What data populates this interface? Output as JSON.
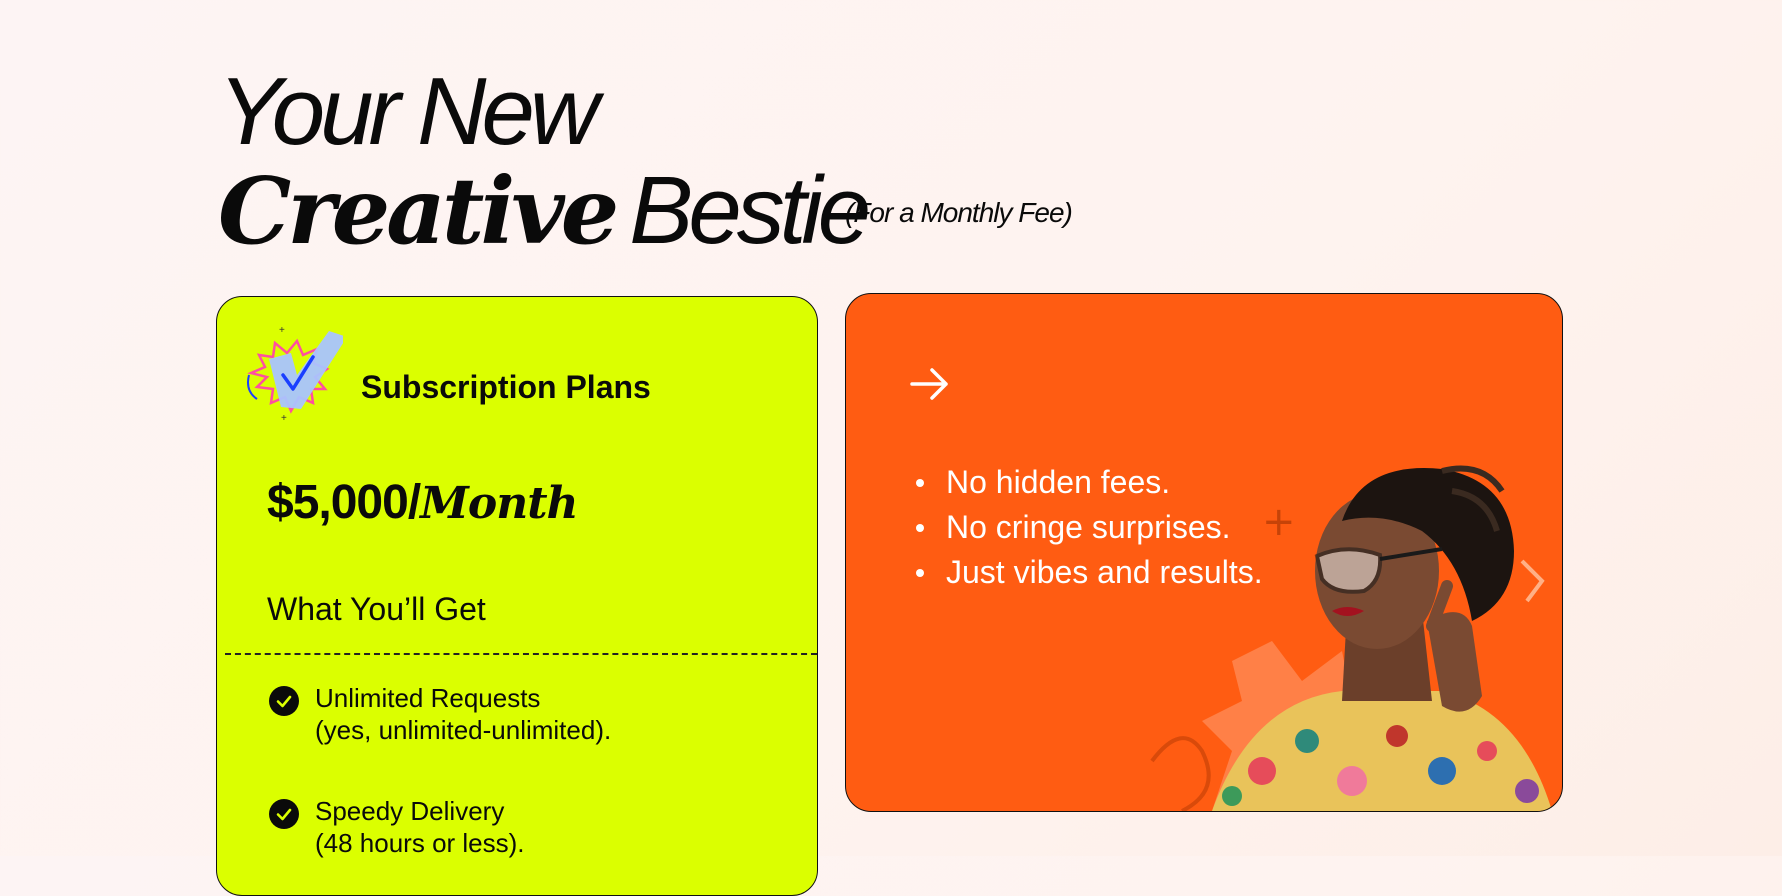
{
  "hero": {
    "line1": "Your New",
    "line2_serif": "Creative",
    "line2_sans": "Bestie",
    "note": "(For a Monthly Fee)"
  },
  "plan": {
    "title": "Subscription Plans",
    "price_amount": "$5,000/",
    "price_unit": "Month",
    "section_heading": "What You’ll Get",
    "features": [
      {
        "line1": "Unlimited Requests",
        "line2": "(yes, unlimited-unlimited)."
      },
      {
        "line1": "Speedy Delivery",
        "line2": "(48 hours or less)."
      }
    ],
    "card_color": "#dbff00"
  },
  "promo": {
    "arrow_icon": "arrow-right-icon",
    "bullets": [
      "No hidden fees.",
      "No cringe surprises.",
      "Just vibes and results."
    ],
    "card_color": "#ff5c12"
  }
}
